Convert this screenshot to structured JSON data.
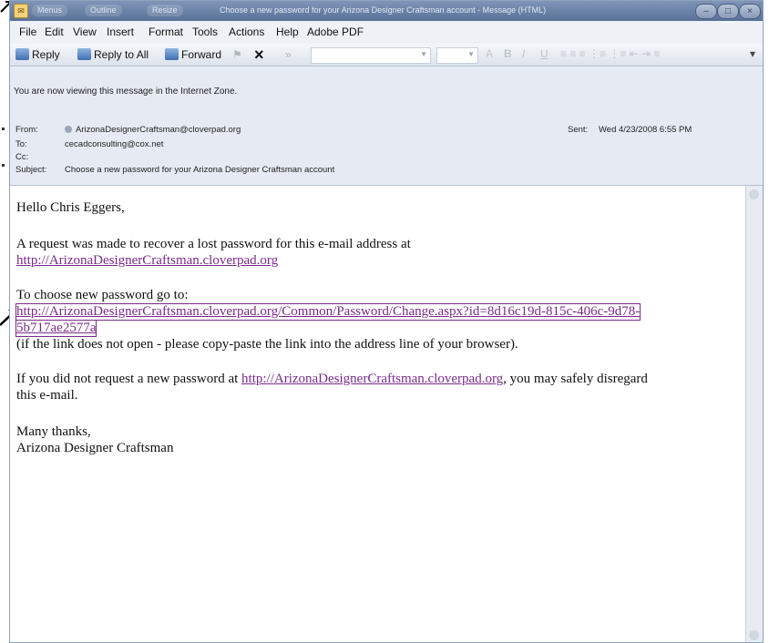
{
  "titlebar": {
    "app_icon": "outlook-message-icon",
    "pill1": "Menus",
    "pill2": "Outline",
    "pill3": "Resize",
    "title": "Choose a new password for your Arizona Designer Craftsman account - Message (HTML)"
  },
  "menu": [
    "File",
    "Edit",
    "View",
    "Insert",
    "Format",
    "Tools",
    "Actions",
    "Help",
    "Adobe PDF"
  ],
  "toolbar": {
    "reply": "Reply",
    "reply_all": "Reply to All",
    "forward": "Forward",
    "delete_icon": "×"
  },
  "header": {
    "zone_notice": "You are now viewing this message in the Internet Zone.",
    "from_label": "From:",
    "from_value": "ArizonaDesignerCraftsman@cloverpad.org",
    "to_label": "To:",
    "to_value": "cecadconsulting@cox.net",
    "cc_label": "Cc:",
    "cc_value": "",
    "subject_label": "Subject:",
    "subject_value": "Choose a new password for your Arizona Designer Craftsman account",
    "sent_label": "Sent:",
    "sent_value": "Wed 4/23/2008 6:55 PM"
  },
  "body": {
    "greeting": "Hello Chris Eggers,",
    "line1": "A request was made to recover a lost password for this e-mail address at",
    "link1": "http://ArizonaDesignerCraftsman.cloverpad.org",
    "line2": "To choose new password go to:",
    "link2_a": "http://ArizonaDesignerCraftsman.cloverpad.org/Common/Password/Change.aspx?id=8d16c19d-815c-406c-9d78-",
    "link2_b": "5b717ae2577a",
    "line3": "(if the link does not open - please copy-paste the link into the address line of your browser).",
    "line4_a": "If you did not request a new password at ",
    "link3": "http://ArizonaDesignerCraftsman.cloverpad.org",
    "line4_b": ", you may safely disregard",
    "line4_c": "this e-mail.",
    "closing1": "Many thanks,",
    "closing2": "Arizona Designer Craftsman"
  }
}
